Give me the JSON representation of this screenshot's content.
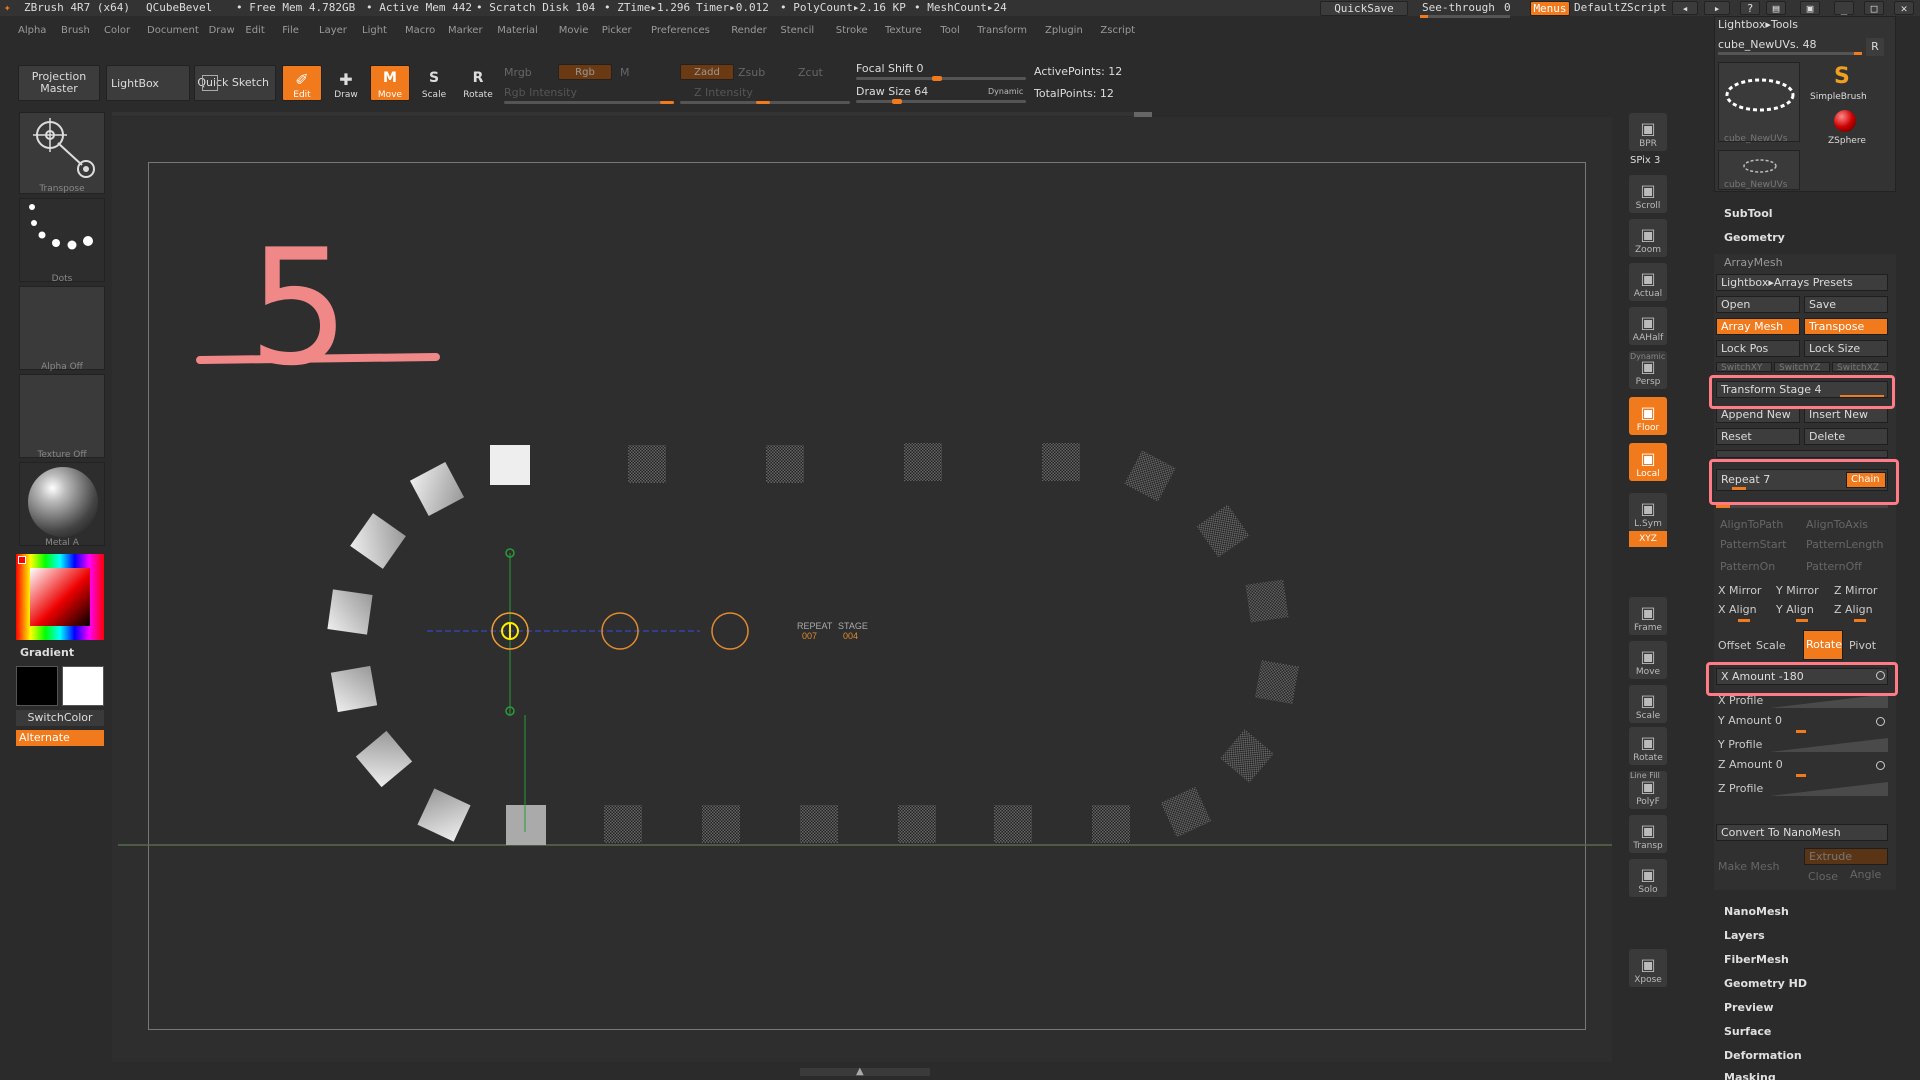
{
  "titlebar": {
    "app": "ZBrush 4R7 (x64)",
    "doc": "QCubeBevel",
    "free_mem": "• Free Mem 4.782GB",
    "active_mem": "• Active Mem 442",
    "scratch": "• Scratch Disk 104",
    "ztime": "• ZTime▸1.296",
    "timer": "Timer▸0.012",
    "polycount": "• PolyCount▸2.16 KP",
    "meshcount": "• MeshCount▸24",
    "quicksave": "QuickSave",
    "seethrough": "See-through",
    "seethrough_val": "0",
    "menus": "Menus",
    "script": "DefaultZScript"
  },
  "menubar": [
    "Alpha",
    "Brush",
    "Color",
    "Document",
    "Draw",
    "Edit",
    "File",
    "Layer",
    "Light",
    "Macro",
    "Marker",
    "Material",
    "Movie",
    "Picker",
    "Preferences",
    "Render",
    "Stencil",
    "Stroke",
    "Texture",
    "Tool",
    "Transform",
    "Zplugin",
    "Zscript"
  ],
  "shelf": {
    "projection_master": "Projection Master",
    "lightbox": "LightBox",
    "quick_sketch": "Quick Sketch",
    "edit": "Edit",
    "draw": "Draw",
    "move": "Move",
    "scale": "Scale",
    "rotate": "Rotate",
    "mrgb": "Mrgb",
    "rgb": "Rgb",
    "m": "M",
    "rgb_intensity": "Rgb Intensity",
    "zadd": "Zadd",
    "zsub": "Zsub",
    "zcut": "Zcut",
    "z_intensity": "Z Intensity",
    "focal_shift": "Focal Shift 0",
    "draw_size": "Draw Size 64",
    "dynamic": "Dynamic",
    "active_points": "ActivePoints: 12",
    "total_points": "TotalPoints: 12"
  },
  "left": {
    "transpose": "Transpose",
    "dots": "Dots",
    "alpha_off": "Alpha Off",
    "texture_off": "Texture Off",
    "material": "Metal A",
    "gradient": "Gradient",
    "switchcolor": "SwitchColor",
    "alternate": "Alternate"
  },
  "canvas": {
    "annotation": "5",
    "repeat_label": "REPEAT",
    "repeat_val": "007",
    "stage_label": "STAGE",
    "stage_val": "004"
  },
  "righttools": [
    {
      "label": "BPR",
      "orange": false
    },
    {
      "label": "Scroll",
      "orange": false
    },
    {
      "label": "Zoom",
      "orange": false
    },
    {
      "label": "Actual",
      "orange": false
    },
    {
      "label": "AAHalf",
      "orange": false
    },
    {
      "label": "Persp",
      "orange": false
    },
    {
      "label": "Floor",
      "orange": true
    },
    {
      "label": "Local",
      "orange": true
    },
    {
      "label": "L.Sym",
      "orange": false
    },
    {
      "label": "Frame",
      "orange": false
    },
    {
      "label": "Move",
      "orange": false
    },
    {
      "label": "Scale",
      "orange": false
    },
    {
      "label": "Rotate",
      "orange": false
    },
    {
      "label": "PolyF",
      "orange": false
    },
    {
      "label": "Transp",
      "orange": false
    },
    {
      "label": "Solo",
      "orange": false
    },
    {
      "label": "Xpose",
      "orange": false
    }
  ],
  "spix": "SPix 3",
  "dynamic_label": "Dynamic",
  "linefill": "Line Fill",
  "xyz": "XYZ",
  "panel": {
    "lightbox_tools": "Lightbox▸Tools",
    "tool_name": "cube_NewUVs. 48",
    "r": "R",
    "thumb1": "cube_NewUVs",
    "thumb2": "cube_NewUVs",
    "simplebrush": "SimpleBrush",
    "zsphere": "ZSphere",
    "subtool": "SubTool",
    "geometry": "Geometry",
    "arraymesh": "ArrayMesh",
    "lb_arrays": "Lightbox▸Arrays Presets",
    "open": "Open",
    "save": "Save",
    "array_mesh": "Array Mesh",
    "transpose": "Transpose",
    "lock_pos": "Lock Pos",
    "lock_size": "Lock Size",
    "switch1": "SwitchXY",
    "switch2": "SwitchYZ",
    "switch3": "SwitchXZ",
    "transform_stage": "Transform Stage 4",
    "append_new": "Append New",
    "insert_new": "Insert New",
    "reset": "Reset",
    "delete": "Delete",
    "repeat": "Repeat 7",
    "chain": "Chain",
    "align_path": "AlignToPath",
    "align_axis": "AlignToAxis",
    "pattern_start": "PatternStart",
    "pattern_length": "PatternLength",
    "pattern_on": "PatternOn",
    "pattern_off": "PatternOff",
    "x_mirror": "X Mirror",
    "y_mirror": "Y Mirror",
    "z_mirror": "Z Mirror",
    "x_align": "X Align",
    "y_align": "Y Align",
    "z_align": "Z Align",
    "offset": "Offset",
    "scale": "Scale",
    "rotate": "Rotate",
    "pivot": "Pivot",
    "x_amount": "X Amount -180",
    "x_profile": "X Profile",
    "y_amount": "Y Amount 0",
    "y_profile": "Y Profile",
    "z_amount": "Z Amount 0",
    "z_profile": "Z Profile",
    "convert": "Convert To NanoMesh",
    "extrude": "Extrude",
    "make_mesh": "Make Mesh",
    "close": "Close",
    "angle": "Angle",
    "nanomesh": "NanoMesh",
    "layers": "Layers",
    "fibermesh": "FiberMesh",
    "geometry_hd": "Geometry HD",
    "preview": "Preview",
    "surface": "Surface",
    "deformation": "Deformation",
    "masking": "Masking"
  },
  "colors": {
    "accent": "#f07a1c",
    "highlight": "#ff7b86",
    "bg": "#2b2b2b"
  }
}
